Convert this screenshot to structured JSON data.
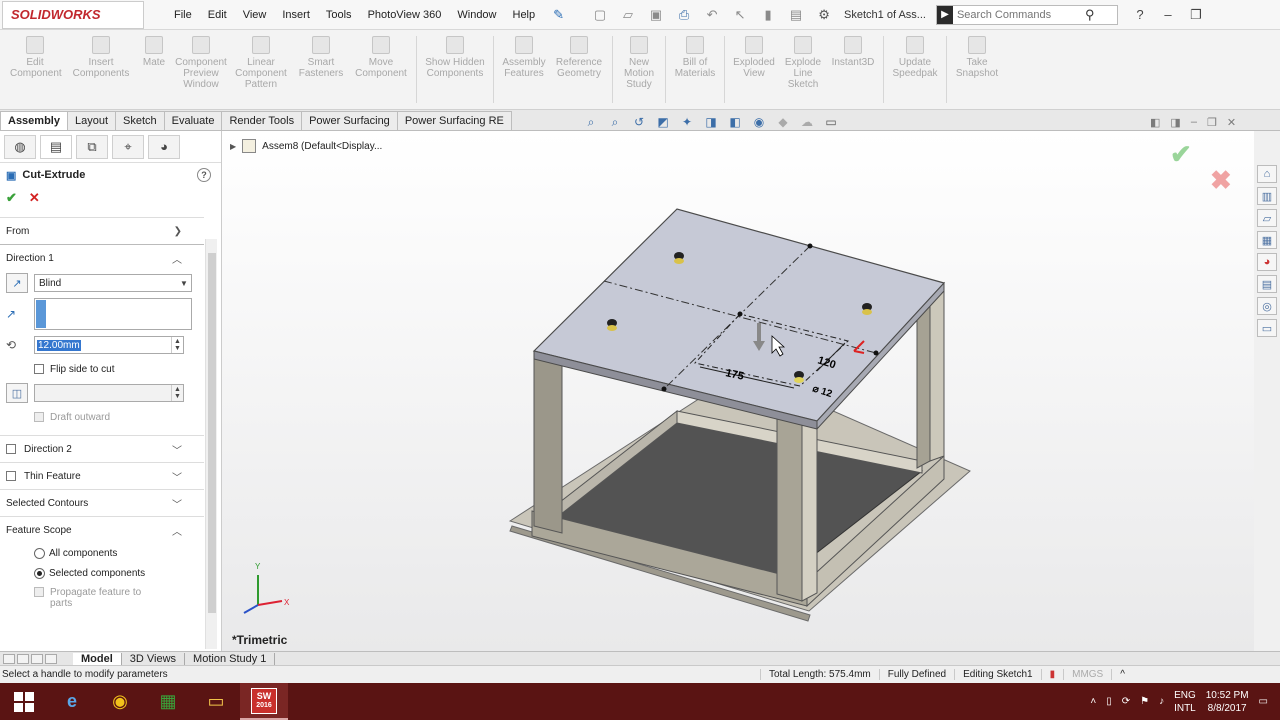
{
  "app": {
    "logo": "SOLIDWORKS",
    "doc_title": "Sketch1 of Ass..."
  },
  "menu": [
    "File",
    "Edit",
    "View",
    "Insert",
    "Tools",
    "PhotoView 360",
    "Window",
    "Help"
  ],
  "search": {
    "placeholder": "Search Commands"
  },
  "command_manager": [
    "Edit Component",
    "Insert Components",
    "Mate",
    "Component Preview Window",
    "Linear Component Pattern",
    "Smart Fasteners",
    "Move Component",
    "Show Hidden Components",
    "Assembly Features",
    "Reference Geometry",
    "New Motion Study",
    "Bill of Materials",
    "Exploded View",
    "Explode Line Sketch",
    "Instant3D",
    "Update Speedpak",
    "Take Snapshot"
  ],
  "tabs": [
    "Assembly",
    "Layout",
    "Sketch",
    "Evaluate",
    "Render Tools",
    "Power Surfacing",
    "Power Surfacing RE"
  ],
  "active_tab": "Assembly",
  "property_manager": {
    "title": "Cut-Extrude",
    "ok": "✔",
    "cancel": "✕",
    "from_label": "From",
    "direction1_label": "Direction 1",
    "end_condition": "Blind",
    "depth": "12.00mm",
    "flip_side": "Flip side to cut",
    "draft_outward": "Draft outward",
    "direction2_label": "Direction 2",
    "thin_feature_label": "Thin Feature",
    "selected_contours_label": "Selected Contours",
    "feature_scope_label": "Feature Scope",
    "all_components": "All components",
    "selected_components": "Selected components",
    "propagate": "Propagate feature to parts"
  },
  "viewport": {
    "tree_item": "Assem8  (Default<Display...",
    "view_name": "*Trimetric",
    "dim_175": "175",
    "dim_120": "120",
    "dim_dia": "⌀ 12",
    "axis_x": "X",
    "axis_y": "Y"
  },
  "bottom_tabs": [
    "Model",
    "3D Views",
    "Motion Study 1"
  ],
  "status": {
    "message": "Select a handle to modify parameters",
    "total_length": "Total Length: 575.4mm",
    "state": "Fully Defined",
    "editing": "Editing Sketch1",
    "units": "MMGS"
  },
  "taskbar": {
    "sw_label_1": "SW",
    "sw_label_2": "2016",
    "lang_1": "ENG",
    "lang_2": "INTL",
    "time": "10:52 PM",
    "date": "8/8/2017"
  },
  "colors": {
    "accent": "#c1272d",
    "taskbar": "#5a1413",
    "ok": "#3aa13a",
    "cancel": "#d32222",
    "selection": "#3577cf"
  }
}
